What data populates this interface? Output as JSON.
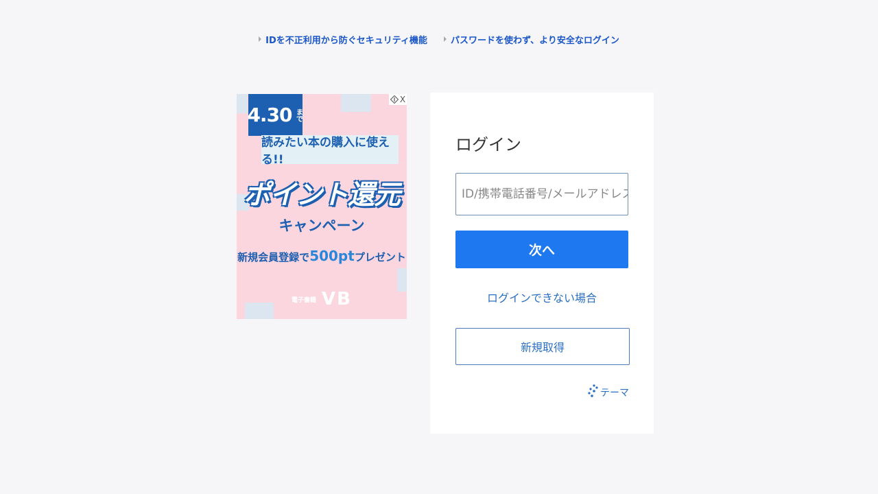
{
  "top_links": [
    {
      "label": "IDを不正利用から防ぐセキュリティ機能"
    },
    {
      "label": "パスワードを使わず、より安全なログイン"
    }
  ],
  "ad": {
    "date": "4.30",
    "date_suffix": "まで",
    "subtitle": "読みたい本の購入に使える!!",
    "title": "ポイント還元",
    "campaign": "キャンペーン",
    "present_prefix": "新規会員登録で",
    "present_points": "500pt",
    "present_suffix": "プレゼント",
    "brand_small": "電子書籍",
    "brand_logo": "VB",
    "close_label": "X",
    "colors": {
      "background": "#fbd6de",
      "accent": "#1d5fb0"
    }
  },
  "login": {
    "title": "ログイン",
    "input_placeholder": "ID/携帯電話番号/メールアドレス",
    "input_value": "",
    "next_button": "次へ",
    "cannot_login_link": "ログインできない場合",
    "register_button": "新規取得",
    "theme_label": "テーマ",
    "colors": {
      "primary": "#1e78f0",
      "link": "#2a6fc4"
    }
  },
  "icons": {
    "top_link_arrow": "triangle-right-icon",
    "ad_info": "ad-choices-icon",
    "theme": "theme-dots-icon"
  }
}
